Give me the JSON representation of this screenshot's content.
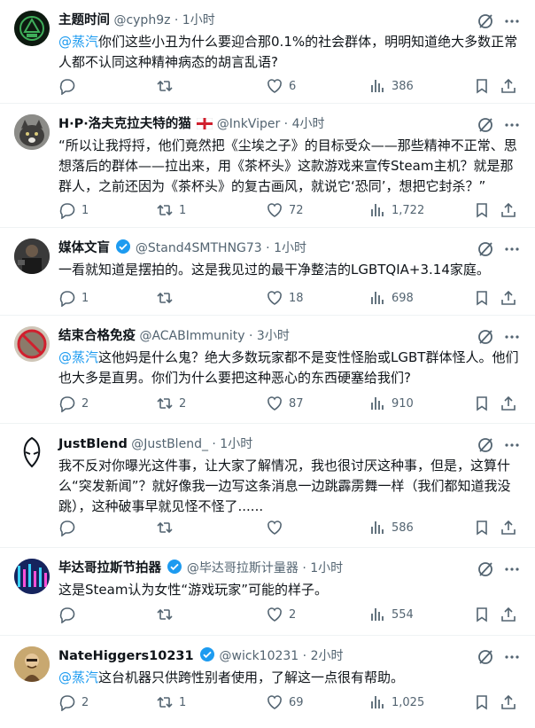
{
  "tweets": [
    {
      "name": "主题时间",
      "handle": "@cyph9z",
      "time": "· 1小时",
      "flag": false,
      "verified": false,
      "mention": "@蒸汽",
      "text": "你们这些小丑为什么要迎合那0.1%的社会群体，明明知道绝大多数正常人都不认同这种精神病态的胡言乱语?",
      "replies": "",
      "retweets": "",
      "likes": "6",
      "views": "386"
    },
    {
      "name": "H·P·洛夫克拉夫特的猫",
      "handle": "@InkViper",
      "time": "· 4小时",
      "flag": true,
      "verified": false,
      "mention": "",
      "text": "“所以让我捋捋，他们竟然把《尘埃之子》的目标受众——那些精神不正常、思想落后的群体——拉出来，用《茶杯头》这款游戏来宣传Steam主机？就是那群人，之前还因为《茶杯头》的复古画风，就说它‘恐同’，想把它封杀？”",
      "replies": "1",
      "retweets": "1",
      "likes": "72",
      "views": "1,722"
    },
    {
      "name": "媒体文盲",
      "handle": "@Stand4SMTHNG73",
      "time": "· 1小时",
      "flag": false,
      "verified": true,
      "mention": "",
      "text": "一看就知道是摆拍的。这是我见过的最干净整洁的LGBTQIA+3.14家庭。",
      "replies": "1",
      "retweets": "",
      "likes": "18",
      "views": "698"
    },
    {
      "name": "结束合格免疫",
      "handle": "@ACABImmunity",
      "time": "· 3小时",
      "flag": false,
      "verified": false,
      "mention": "@蒸汽",
      "text": "这他妈是什么鬼？绝大多数玩家都不是变性怪胎或LGBT群体怪人。他们也大多是直男。你们为什么要把这种恶心的东西硬塞给我们?",
      "replies": "2",
      "retweets": "2",
      "likes": "87",
      "views": "910"
    },
    {
      "name": "JustBlend",
      "handle": "@JustBlend_",
      "time": "· 1小时",
      "flag": false,
      "verified": false,
      "mention": "",
      "text": "我不反对你曝光这件事，让大家了解情况，我也很讨厌这种事，但是，这算什么“突发新闻”？就好像我一边写这条消息一边跳霹雳舞一样（我们都知道我没跳），这种破事早就见怪不怪了......",
      "replies": "",
      "retweets": "",
      "likes": "",
      "views": "586"
    },
    {
      "name": "毕达哥拉斯节拍器",
      "handle": "@毕达哥拉斯计量器",
      "time": "· 1小时",
      "flag": false,
      "verified": true,
      "mention": "",
      "text": "这是Steam认为女性“游戏玩家”可能的样子。",
      "replies": "",
      "retweets": "",
      "likes": "2",
      "views": "554"
    },
    {
      "name": "NateHiggers10231",
      "handle": "@wick10231",
      "time": "· 2小时",
      "flag": false,
      "verified": true,
      "mention": "@蒸汽",
      "text": "这台机器只供跨性别者使用，了解这一点很有帮助。",
      "replies": "2",
      "retweets": "1",
      "likes": "69",
      "views": "1,025"
    }
  ],
  "colors": {
    "accent": "#1d9bf0",
    "muted": "#536471",
    "text": "#0f1419",
    "verified": "#1d9bf0"
  }
}
